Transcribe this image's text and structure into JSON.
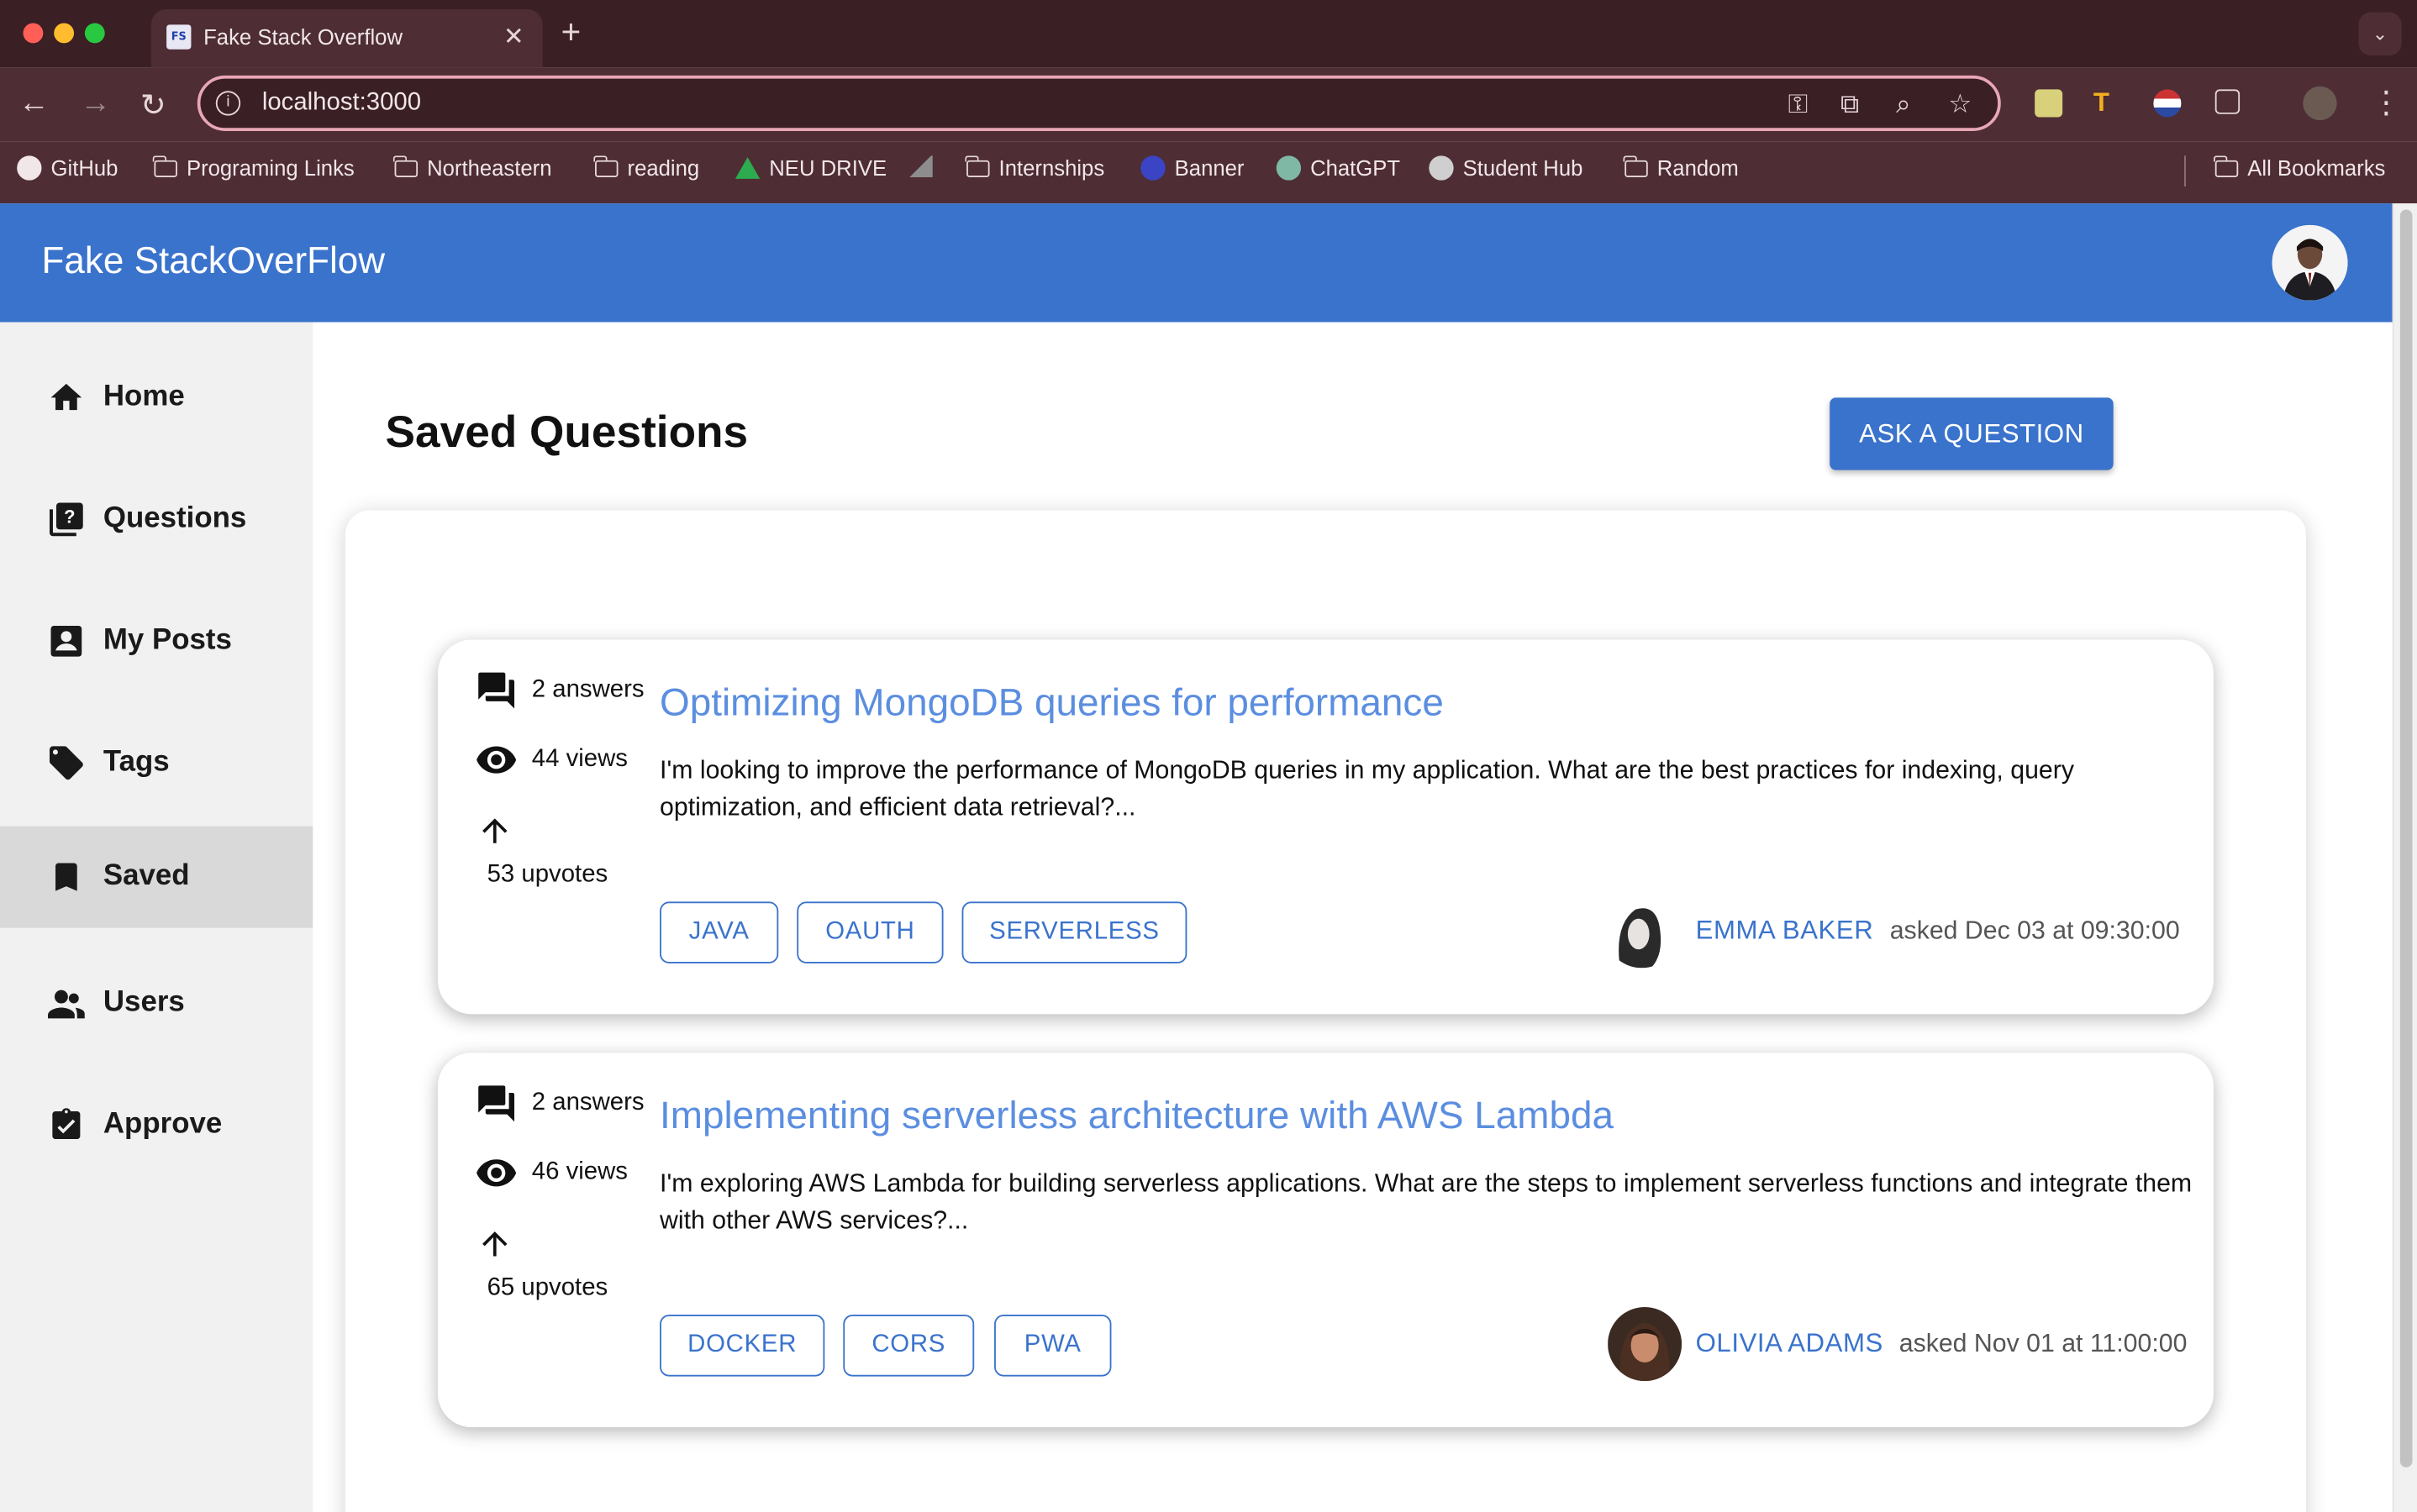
{
  "browser": {
    "tab_title": "Fake Stack Overflow",
    "tab_favicon_text": "FS",
    "url": "localhost:3000",
    "bookmarks": [
      {
        "label": "GitHub",
        "icon": "github-icon"
      },
      {
        "label": "Programing Links",
        "icon": "folder-icon"
      },
      {
        "label": "Northeastern",
        "icon": "folder-icon"
      },
      {
        "label": "reading",
        "icon": "folder-icon"
      },
      {
        "label": "NEU DRIVE",
        "icon": "google-drive-icon"
      },
      {
        "label": "Internships",
        "icon": "folder-icon"
      },
      {
        "label": "Banner",
        "icon": "banner-icon"
      },
      {
        "label": "ChatGPT",
        "icon": "chatgpt-icon"
      },
      {
        "label": "Student Hub",
        "icon": "globe-icon"
      },
      {
        "label": "Random",
        "icon": "folder-icon"
      }
    ],
    "all_bookmarks": "All Bookmarks"
  },
  "app": {
    "brand": "Fake StackOverFlow",
    "accent_color": "#3a73cc"
  },
  "sidebar": {
    "items": [
      {
        "label": "Home",
        "icon": "home-icon"
      },
      {
        "label": "Questions",
        "icon": "question-library-icon"
      },
      {
        "label": "My Posts",
        "icon": "account-box-icon"
      },
      {
        "label": "Tags",
        "icon": "tag-icon"
      },
      {
        "label": "Saved",
        "icon": "bookmark-icon",
        "active": true
      },
      {
        "label": "Users",
        "icon": "people-icon"
      },
      {
        "label": "Approve",
        "icon": "assignment-check-icon"
      }
    ]
  },
  "main": {
    "title": "Saved Questions",
    "ask_button": "ASK A QUESTION",
    "questions": [
      {
        "answers": "2 answers",
        "views": "44 views",
        "upvotes": "53 upvotes",
        "title": "Optimizing MongoDB queries for performance",
        "text": "I'm looking to improve the performance of MongoDB queries in my application. What are the best practices for indexing, query optimization, and efficient data retrieval?...",
        "tags": [
          "JAVA",
          "OAUTH",
          "SERVERLESS"
        ],
        "author": "EMMA BAKER",
        "asked": "asked Dec 03 at 09:30:00"
      },
      {
        "answers": "2 answers",
        "views": "46 views",
        "upvotes": "65 upvotes",
        "title": "Implementing serverless architecture with AWS Lambda",
        "text": "I'm exploring AWS Lambda for building serverless applications. What are the steps to implement serverless functions and integrate them with other AWS services?...",
        "tags": [
          "DOCKER",
          "CORS",
          "PWA"
        ],
        "author": "OLIVIA ADAMS",
        "asked": "asked Nov 01 at 11:00:00"
      }
    ]
  }
}
